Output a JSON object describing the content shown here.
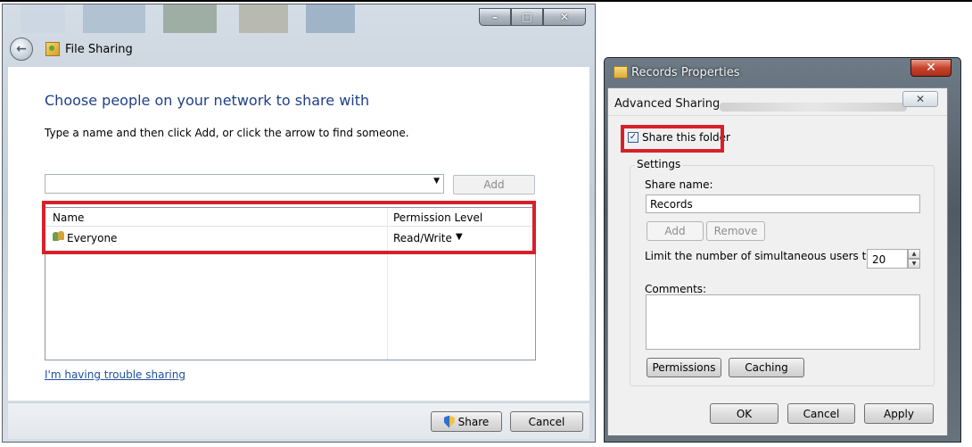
{
  "file_sharing": {
    "title": "File Sharing",
    "heading": "Choose people on your network to share with",
    "instructions": "Type a name and then click Add, or click the arrow to find someone.",
    "name_input": {
      "value": "",
      "placeholder": ""
    },
    "add_label": "Add",
    "columns": {
      "name": "Name",
      "permission": "Permission Level"
    },
    "rows": [
      {
        "name": "Everyone",
        "permission": "Read/Write"
      }
    ],
    "trouble_link": "I'm having trouble sharing",
    "share_label": "Share",
    "cancel_label": "Cancel",
    "caption_buttons": {
      "minimize": "–",
      "maximize": "□",
      "close": "✕"
    },
    "back_glyph": "←",
    "dropdown_glyph": "▼"
  },
  "records_properties": {
    "title": "Records Properties",
    "close_glyph": "✕"
  },
  "advanced_sharing": {
    "title": "Advanced Sharing",
    "close_glyph": "✕",
    "share_checkbox": {
      "label": "Share this folder",
      "checked_glyph": "✓"
    },
    "settings_label": "Settings",
    "share_name_label": "Share name:",
    "share_name_value": "Records",
    "add_label": "Add",
    "remove_label": "Remove",
    "limit_label": "Limit the number of simultaneous users to:",
    "limit_value": "20",
    "spin_up": "▲",
    "spin_down": "▼",
    "comments_label": "Comments:",
    "comments_value": "",
    "permissions_label": "Permissions",
    "caching_label": "Caching",
    "ok_label": "OK",
    "cancel_label": "Cancel",
    "apply_label": "Apply"
  }
}
